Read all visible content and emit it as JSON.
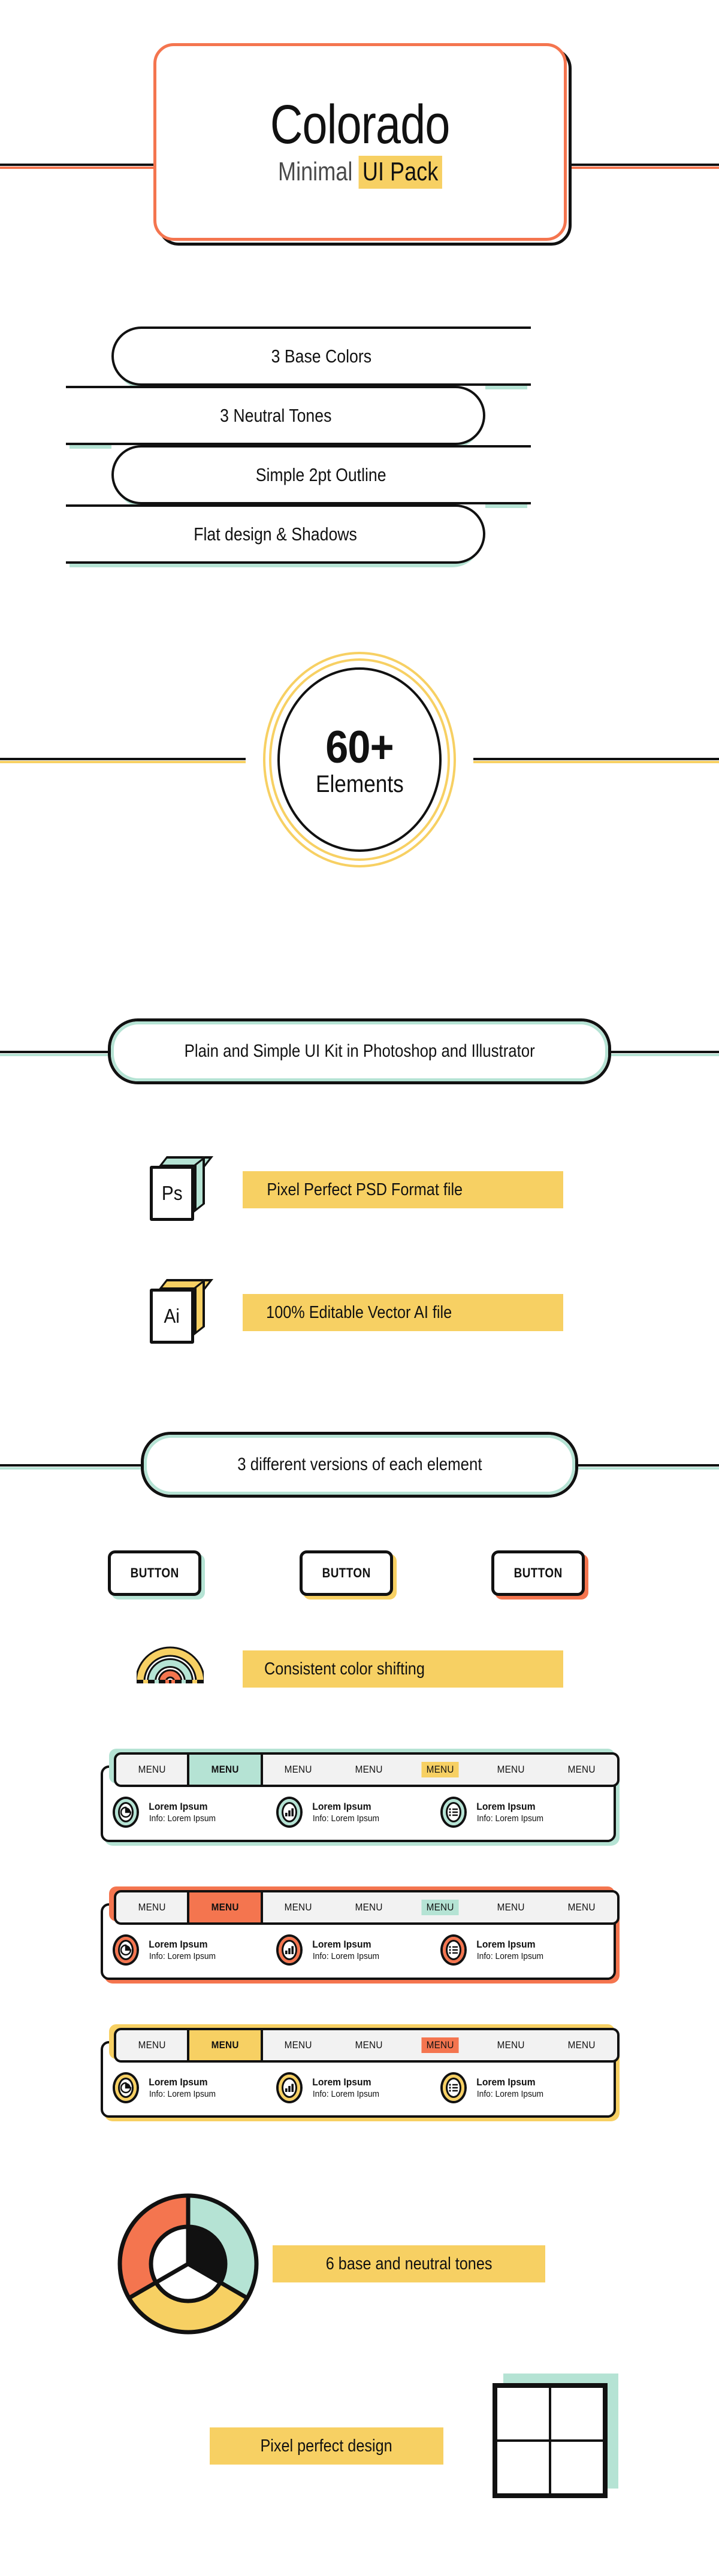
{
  "colors": {
    "orange": "#F4754F",
    "yellow": "#F7D063",
    "mint": "#B5E3D4",
    "black": "#111111",
    "gray_bar": "#F2F2F2"
  },
  "hero": {
    "title": "Colorado",
    "subtitle_plain": "Minimal ",
    "subtitle_highlight": "UI Pack"
  },
  "features": {
    "pills": [
      {
        "label": "3 Base Colors"
      },
      {
        "label": "3 Neutral Tones"
      },
      {
        "label": "Simple 2pt Outline"
      },
      {
        "label": "Flat design & Shadows"
      }
    ]
  },
  "badge": {
    "number": "60+",
    "label": "Elements"
  },
  "kit_pill": {
    "label": "Plain and Simple UI Kit in Photoshop and Illustrator"
  },
  "formats": [
    {
      "icon": "photoshop-icon",
      "abbr": "Ps",
      "label": "Pixel Perfect PSD Format file",
      "side_color": "#B5E3D4"
    },
    {
      "icon": "illustrator-icon",
      "abbr": "Ai",
      "label": "100% Editable Vector AI file",
      "side_color": "#F7D063"
    }
  ],
  "versions_pill": {
    "label": "3 different versions of each element"
  },
  "buttons": [
    {
      "label": "BUTTON",
      "shadow_color": "#B5E3D4"
    },
    {
      "label": "BUTTON",
      "shadow_color": "#F7D063"
    },
    {
      "label": "BUTTON",
      "shadow_color": "#F4754F"
    }
  ],
  "color_shift": {
    "label": "Consistent color shifting"
  },
  "navbars": [
    {
      "accent": "#B5E3D4",
      "tabs": [
        {
          "label": "MENU",
          "state": "normal"
        },
        {
          "label": "MENU",
          "state": "active"
        },
        {
          "label": "MENU",
          "state": "normal"
        },
        {
          "label": "MENU",
          "state": "normal"
        },
        {
          "label": "MENU",
          "state": "highlight"
        },
        {
          "label": "MENU",
          "state": "normal"
        },
        {
          "label": "MENU",
          "state": "normal"
        }
      ],
      "highlight_color": "#F7D063",
      "items": [
        {
          "icon": "pie-chart-icon",
          "title": "Lorem Ipsum",
          "info": "Info: Lorem Ipsum"
        },
        {
          "icon": "bar-chart-icon",
          "title": "Lorem Ipsum",
          "info": "Info: Lorem Ipsum"
        },
        {
          "icon": "list-icon",
          "title": "Lorem Ipsum",
          "info": "Info: Lorem Ipsum"
        }
      ]
    },
    {
      "accent": "#F4754F",
      "tabs": [
        {
          "label": "MENU",
          "state": "normal"
        },
        {
          "label": "MENU",
          "state": "active"
        },
        {
          "label": "MENU",
          "state": "normal"
        },
        {
          "label": "MENU",
          "state": "normal"
        },
        {
          "label": "MENU",
          "state": "highlight"
        },
        {
          "label": "MENU",
          "state": "normal"
        },
        {
          "label": "MENU",
          "state": "normal"
        }
      ],
      "highlight_color": "#B5E3D4",
      "items": [
        {
          "icon": "pie-chart-icon",
          "title": "Lorem Ipsum",
          "info": "Info: Lorem Ipsum"
        },
        {
          "icon": "bar-chart-icon",
          "title": "Lorem Ipsum",
          "info": "Info: Lorem Ipsum"
        },
        {
          "icon": "list-icon",
          "title": "Lorem Ipsum",
          "info": "Info: Lorem Ipsum"
        }
      ]
    },
    {
      "accent": "#F7D063",
      "tabs": [
        {
          "label": "MENU",
          "state": "normal"
        },
        {
          "label": "MENU",
          "state": "active"
        },
        {
          "label": "MENU",
          "state": "normal"
        },
        {
          "label": "MENU",
          "state": "normal"
        },
        {
          "label": "MENU",
          "state": "highlight"
        },
        {
          "label": "MENU",
          "state": "normal"
        },
        {
          "label": "MENU",
          "state": "normal"
        }
      ],
      "highlight_color": "#F4754F",
      "items": [
        {
          "icon": "pie-chart-icon",
          "title": "Lorem Ipsum",
          "info": "Info: Lorem Ipsum"
        },
        {
          "icon": "bar-chart-icon",
          "title": "Lorem Ipsum",
          "info": "Info: Lorem Ipsum"
        },
        {
          "icon": "list-icon",
          "title": "Lorem Ipsum",
          "info": "Info: Lorem Ipsum"
        }
      ]
    }
  ],
  "donut": {
    "label": "6 base and neutral tones",
    "outer_segments": [
      "#F4754F",
      "#B5E3D4",
      "#F7D063"
    ],
    "inner_segments": [
      "#FFFFFF",
      "#111111",
      "#FFFFFF"
    ]
  },
  "pixel_perfect": {
    "label": "Pixel perfect design"
  }
}
